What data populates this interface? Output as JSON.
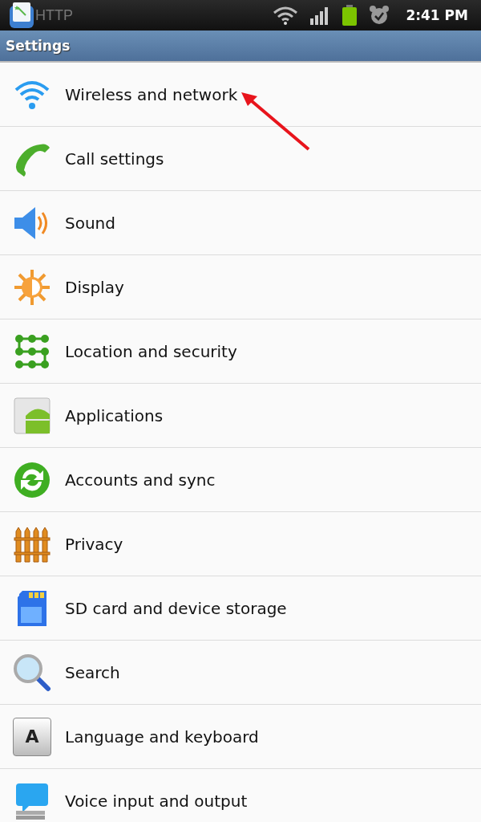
{
  "status_bar": {
    "notification": "HTTP",
    "time": "2:41 PM"
  },
  "title_bar": {
    "title": "Settings"
  },
  "items": [
    {
      "label": "Wireless and network"
    },
    {
      "label": "Call settings"
    },
    {
      "label": "Sound"
    },
    {
      "label": "Display"
    },
    {
      "label": "Location and security"
    },
    {
      "label": "Applications"
    },
    {
      "label": "Accounts and sync"
    },
    {
      "label": "Privacy"
    },
    {
      "label": "SD card and device storage"
    },
    {
      "label": "Search"
    },
    {
      "label": "Language and keyboard",
      "key_glyph": "A"
    },
    {
      "label": "Voice input and output"
    }
  ]
}
